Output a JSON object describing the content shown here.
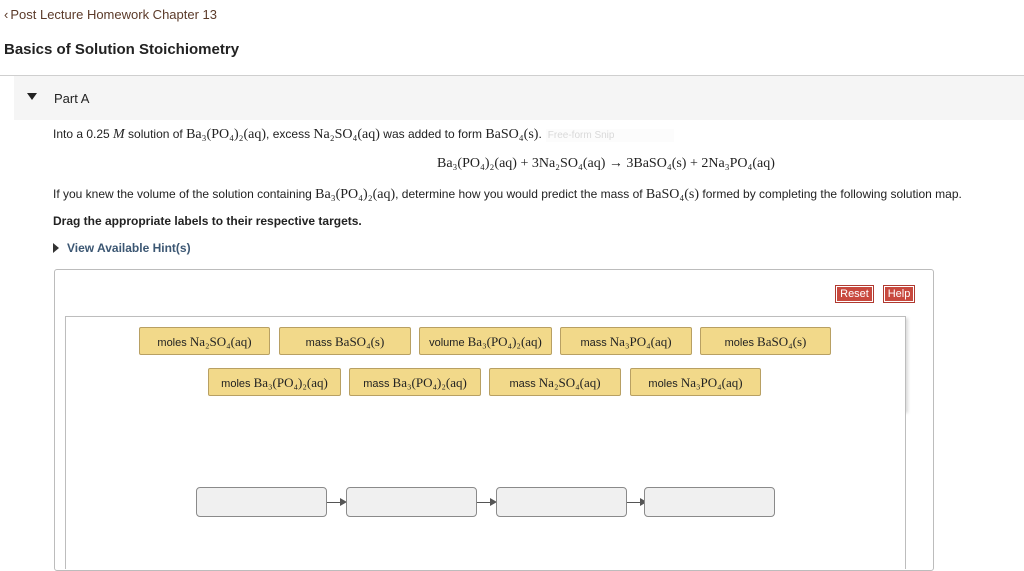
{
  "header": {
    "back_label": "Post Lecture Homework Chapter 13",
    "title": "Basics of Solution Stoichiometry"
  },
  "part": {
    "label": "Part A"
  },
  "problem": {
    "intro_a": "Into a 0.25 ",
    "intro_unit": "M",
    "intro_b": " solution of ",
    "intro_chem1": "Ba₃(PO₄)₂(aq)",
    "intro_c": ", excess ",
    "intro_chem2": "Na₂SO₄(aq)",
    "intro_d": " was added to form ",
    "intro_chem3": "BaSO₄(s)",
    "intro_e": ".",
    "snip_text": "Free-form Snip",
    "equation": "Ba₃(PO₄)₂(aq) + 3Na₂SO₄(aq) → 3BaSO₄(s) + 2Na₃PO₄(aq)",
    "question_a": "If you knew the volume of the solution containing ",
    "question_chem1": "Ba₃(PO₄)₂(aq)",
    "question_b": ", determine how you would predict the mass of ",
    "question_chem2": "BaSO₄(s)",
    "question_c": " formed by completing the following solution map.",
    "instruction": "Drag the appropriate labels to their respective targets.",
    "hints_label": "View Available Hint(s)"
  },
  "controls": {
    "reset_label": "Reset",
    "help_label": "Help"
  },
  "labels": [
    {
      "prefix": "moles ",
      "chem": "Na₂SO₄(aq)"
    },
    {
      "prefix": "mass ",
      "chem": "BaSO₄(s)"
    },
    {
      "prefix": "volume ",
      "chem": "Ba₃(PO₄)₂(aq)"
    },
    {
      "prefix": "mass ",
      "chem": "Na₃PO₄(aq)"
    },
    {
      "prefix": "moles ",
      "chem": "BaSO₄(s)"
    },
    {
      "prefix": "moles ",
      "chem": "Ba₃(PO₄)₂(aq)"
    },
    {
      "prefix": "mass ",
      "chem": "Ba₃(PO₄)₂(aq)"
    },
    {
      "prefix": "mass ",
      "chem": "Na₂SO₄(aq)"
    },
    {
      "prefix": "moles ",
      "chem": "Na₃PO₄(aq)"
    }
  ]
}
